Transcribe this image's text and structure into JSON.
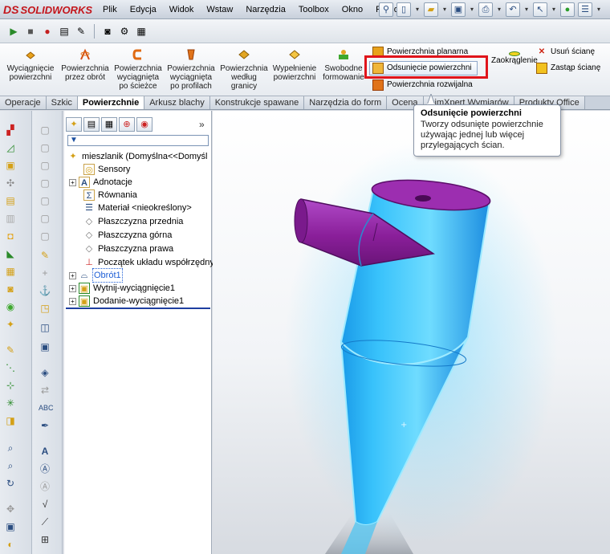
{
  "app": {
    "logo_text": "SOLIDWORKS",
    "logo_ds": "DS"
  },
  "menu": [
    "Plik",
    "Edycja",
    "Widok",
    "Wstaw",
    "Narzędzia",
    "Toolbox",
    "Okno",
    "Pomoc"
  ],
  "ribbon": {
    "buttons": [
      {
        "label": "Wyciągnięcie\npowierzchni",
        "icon": "extrude-surface-icon",
        "color": "#e8a21c"
      },
      {
        "label": "Powierzchnia\nprzez obrót",
        "icon": "revolve-surface-icon",
        "color": "#e0731a"
      },
      {
        "label": "Powierzchnia\nwyciągnięta\npo ścieżce",
        "icon": "sweep-surface-icon",
        "color": "#e06a12"
      },
      {
        "label": "Powierzchnia\nwyciągnięta\npo profilach",
        "icon": "loft-surface-icon",
        "color": "#e0731a"
      },
      {
        "label": "Powierzchnia\nwedług\ngranicy",
        "icon": "boundary-surface-icon",
        "color": "#e2a623"
      },
      {
        "label": "Wypełnienie\npowierzchni",
        "icon": "fill-surface-icon",
        "color": "#e2a623"
      },
      {
        "label": "Swobodne\nformowanie",
        "icon": "freeform-icon",
        "color": "#3ea82f"
      }
    ],
    "small_buttons": {
      "planar": "Powierzchnia planarna",
      "offset": "Odsunięcie powierzchni",
      "ruled": "Powierzchnia rozwijalna",
      "fillet": "Zaokrąglenie",
      "delete_face": "Usuń ścianę",
      "replace_face": "Zastąp ścianę"
    }
  },
  "tabs": [
    {
      "label": "Operacje",
      "active": false
    },
    {
      "label": "Szkic",
      "active": false
    },
    {
      "label": "Powierzchnie",
      "active": true
    },
    {
      "label": "Arkusz blachy",
      "active": false
    },
    {
      "label": "Konstrukcje spawane",
      "active": false
    },
    {
      "label": "Narzędzia do form",
      "active": false
    },
    {
      "label": "Ocena",
      "active": false
    },
    {
      "label": "DimXpert Wymiarów",
      "active": false
    },
    {
      "label": "Produkty Office",
      "active": false
    }
  ],
  "tooltip": {
    "title": "Odsunięcie powierzchni",
    "body": "Tworzy odsunięte powierzchnie używając jednej lub więcej przylegających ścian."
  },
  "tree": {
    "root": "mieszlanik  (Domyślna<<Domyśl",
    "items": [
      {
        "label": "Sensory",
        "icon": "sensor-icon",
        "expand": false
      },
      {
        "label": "Adnotacje",
        "icon": "annotation-icon",
        "expand": true
      },
      {
        "label": "Równania",
        "icon": "equation-icon",
        "expand": false
      },
      {
        "label": "Materiał <nieokreślony>",
        "icon": "material-icon",
        "expand": false
      },
      {
        "label": "Płaszczyzna przednia",
        "icon": "plane-icon",
        "expand": false
      },
      {
        "label": "Płaszczyzna górna",
        "icon": "plane-icon",
        "expand": false
      },
      {
        "label": "Płaszczyzna prawa",
        "icon": "plane-icon",
        "expand": false
      },
      {
        "label": "Początek układu współrzędny",
        "icon": "origin-icon",
        "expand": false
      },
      {
        "label": "Obrót1",
        "icon": "revolve-feature-icon",
        "expand": true,
        "selected": true
      },
      {
        "label": "Wytnij-wyciągnięcie1",
        "icon": "cut-extrude-icon",
        "expand": true
      },
      {
        "label": "Dodanie-wyciągnięcie1",
        "icon": "boss-extrude-icon",
        "expand": true
      }
    ]
  },
  "colors": {
    "highlight": "#e0141b",
    "model_blue": "#2fb3f0",
    "model_purple": "#8a1f9a"
  }
}
